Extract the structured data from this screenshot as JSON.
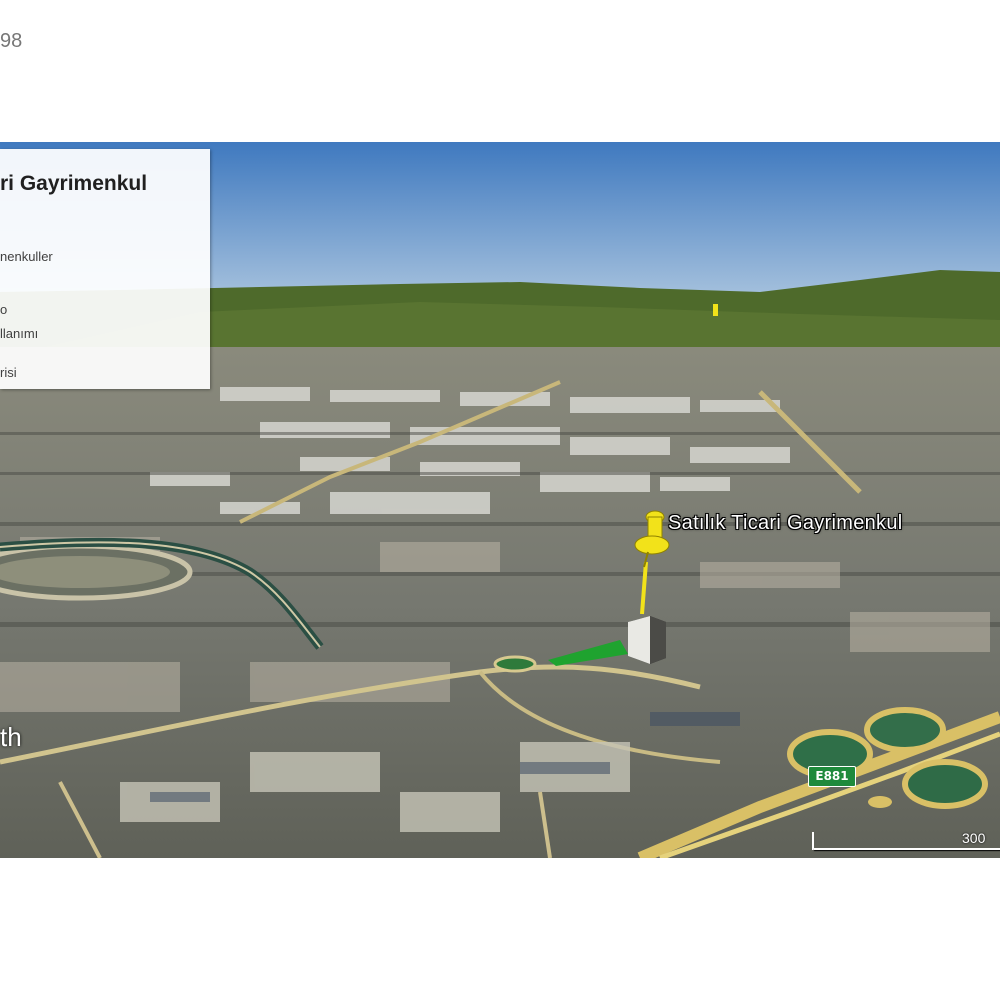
{
  "header": {
    "code_fragment": "98"
  },
  "info_panel": {
    "title": "ri Gayrimenkul",
    "line1": "nenkuller",
    "line2": "o",
    "line3": "llanımı",
    "line4": "risi"
  },
  "placemark": {
    "label": "Satılık Ticari Gayrimenkul",
    "icon": "yellow-pushpin-icon"
  },
  "road": {
    "route_label": "E881"
  },
  "watermark": {
    "text": "th"
  },
  "scale": {
    "label": "300"
  },
  "colors": {
    "sky_top": "#3f79bf",
    "sky_bottom": "#a8c3de",
    "hills": "#4e6a2b",
    "pin": "#f2e21a",
    "parcel": "#1fa32f",
    "highway": "#d9c066",
    "route_shield": "#1f8a3c"
  }
}
